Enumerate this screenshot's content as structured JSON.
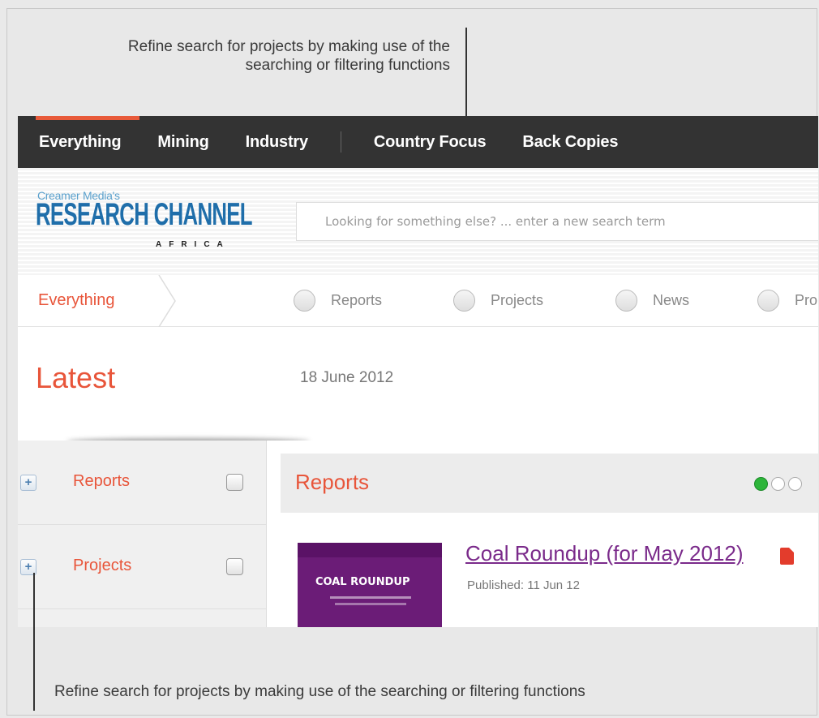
{
  "callouts": {
    "top": "Refine search for projects by making use of the searching or filtering functions",
    "bottom": "Refine search for projects by making use of the searching or filtering functions"
  },
  "topnav": {
    "items": [
      "Everything",
      "Mining",
      "Industry",
      "Country Focus",
      "Back Copies"
    ],
    "active": "Everything"
  },
  "logo": {
    "pre": "Creamer Media's",
    "main": "RESEARCH CHANNEL",
    "sub": "AFRICA"
  },
  "search": {
    "placeholder": "Looking for something else? ... enter a new search term"
  },
  "filterbar": {
    "crumb": "Everything",
    "options": [
      "Reports",
      "Projects",
      "News",
      "Pro"
    ]
  },
  "latest": {
    "title": "Latest",
    "date": "18 June 2012"
  },
  "sidebar": {
    "items": [
      {
        "label": "Reports",
        "expand": "+"
      },
      {
        "label": "Projects",
        "expand": "+"
      }
    ]
  },
  "content": {
    "section_title": "Reports",
    "pager_active": 1,
    "report": {
      "title": "Coal Roundup (for May 2012)",
      "published": "Published: 11 Jun 12",
      "thumb_title": "COAL ROUNDUP"
    }
  },
  "colors": {
    "accent": "#e8553a",
    "nav_bg": "#333333",
    "link": "#7a2a8a",
    "pager_on": "#2db53a"
  }
}
